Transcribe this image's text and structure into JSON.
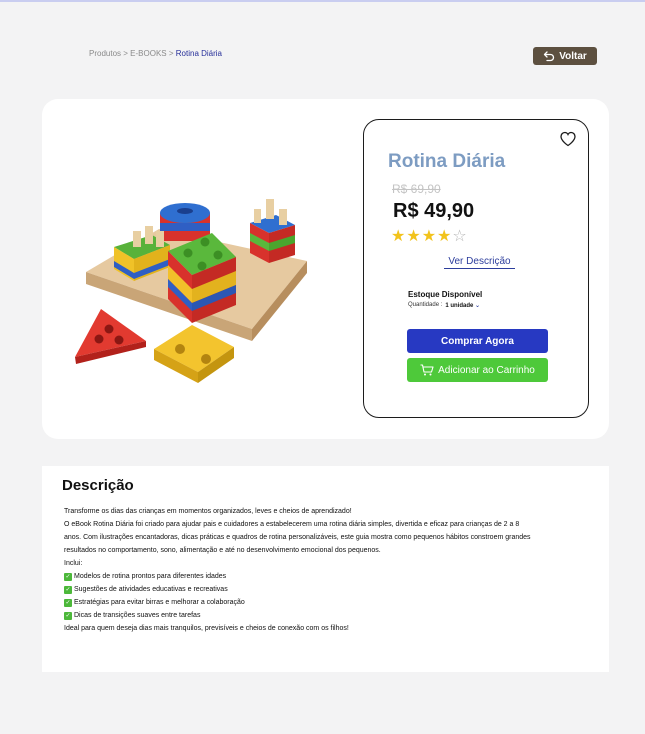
{
  "breadcrumb": {
    "items": [
      "Produtos",
      "E-BOOKS"
    ],
    "separator": ">",
    "current": "Rotina Diária"
  },
  "back_button": {
    "label": "Voltar",
    "icon": "back-arrow-icon"
  },
  "product": {
    "title": "Rotina Diária",
    "old_price": "R$ 69,90",
    "price": "R$ 49,90",
    "rating": 4,
    "rating_max": 5,
    "description_link": "Ver Descrição",
    "stock_label": "Estoque Disponível",
    "quantity_label": "Quantidade :",
    "quantity_value": "1 unidade",
    "buy_label": "Comprar Agora",
    "cart_label": "Adicionar ao Carrinho",
    "favorite_icon": "heart-icon",
    "cart_icon": "shopping-cart-icon"
  },
  "description": {
    "title": "Descrição",
    "intro_lines": [
      "Transforme os dias das crianças em momentos organizados, leves e cheios de aprendizado!",
      "O eBook Rotina Diária  foi criado para ajudar pais e cuidadores a estabelecerem uma rotina diária simples, divertida e eficaz para crianças de 2 a 8 anos. Com ilustrações encantadoras, dicas práticas e quadros de rotina personalizáveis, este guia mostra como pequenos hábitos constroem grandes resultados no comportamento, sono, alimentação e até no desenvolvimento emocional dos pequenos.",
      "Inclui:"
    ],
    "bullets": [
      "Modelos de rotina prontos para diferentes idades",
      "Sugestões de atividades educativas e recreativas",
      "Estratégias para evitar birras e melhorar a colaboração",
      "Dicas de transições suaves entre tarefas"
    ],
    "outro": "Ideal para quem deseja dias mais tranquilos, previsíveis e cheios de conexão com os filhos!"
  },
  "colors": {
    "back_button": "#5d5040",
    "title": "#7d9cc2",
    "buy_button": "#2739c2",
    "cart_button": "#4ec93a",
    "link": "#2c3d9c",
    "check": "#4cb83a"
  }
}
